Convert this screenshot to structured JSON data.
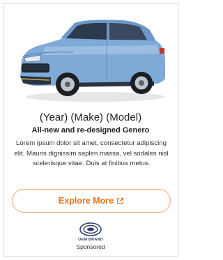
{
  "ad": {
    "title": "(Year) (Make) (Model)",
    "subtitle": "All-new and re-designed Genero",
    "body": "Lorem ipsum dolor sit amet, consectetur adipiscing elit. Mauris dignissim saplen massa, vel sodales nisl scelerisque vitae. Duis at finibus metus.",
    "cta_label": "Explore More",
    "cta_icon": "external-link-icon",
    "brand_name": "OEM BRAND",
    "sponsored_label": "Sponsored"
  },
  "colors": {
    "accent": "#e8731c",
    "button_border": "#f2a66a",
    "car_body": "#7fa9d6",
    "brand": "#2f3f6a"
  }
}
